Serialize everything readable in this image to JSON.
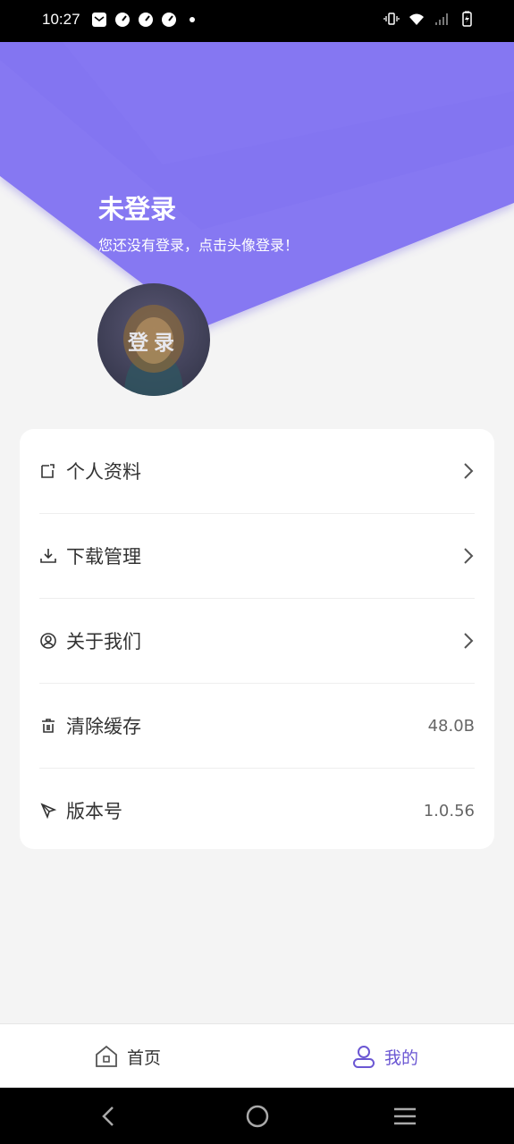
{
  "status_bar": {
    "time": "10:27"
  },
  "header": {
    "title": "未登录",
    "subtitle": "您还没有登录，点击头像登录！"
  },
  "avatar": {
    "label": "登录"
  },
  "menu": {
    "items": [
      {
        "label": "个人资料",
        "icon": "edit-icon",
        "value": ""
      },
      {
        "label": "下载管理",
        "icon": "download-icon",
        "value": ""
      },
      {
        "label": "关于我们",
        "icon": "user-circle-icon",
        "value": ""
      },
      {
        "label": "清除缓存",
        "icon": "trash-icon",
        "value": "48.0B"
      },
      {
        "label": "版本号",
        "icon": "rocket-icon",
        "value": "1.0.56"
      }
    ]
  },
  "tabbar": {
    "home_label": "首页",
    "mine_label": "我的"
  },
  "colors": {
    "accent": "#6b57d3",
    "banner": "#7b6cf0"
  }
}
